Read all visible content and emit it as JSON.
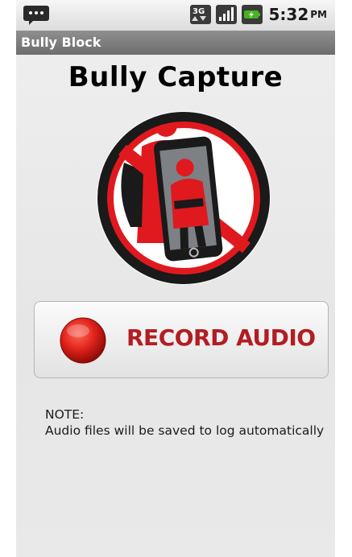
{
  "status_bar": {
    "notification_icon": "chat-bubble-icon",
    "network_icon": "3g-icon",
    "signal_icon": "signal-strength-icon",
    "battery_icon": "battery-charging-icon",
    "time": "5:32",
    "ampm": "PM"
  },
  "app": {
    "title": "Bully Block"
  },
  "main": {
    "headline": "Bully Capture",
    "logo": "no-bully-phone-logo",
    "record_button": {
      "label": "RECORD AUDIO",
      "icon": "record-dot-icon"
    },
    "note_label": "NOTE:",
    "note_text": "Audio files will be saved to log automatically"
  },
  "colors": {
    "accent_red": "#b21d23",
    "prohibition_red": "#e0191f",
    "title_bar": "#7a7a7a"
  }
}
